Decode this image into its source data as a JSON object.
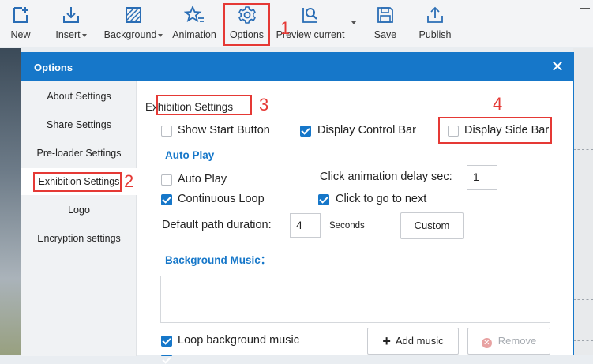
{
  "toolbar": {
    "new": "New",
    "insert": "Insert",
    "background": "Background",
    "animation": "Animation",
    "options": "Options",
    "preview": "Preview current",
    "save": "Save",
    "publish": "Publish"
  },
  "callouts": [
    "1",
    "2",
    "3",
    "4"
  ],
  "dialog": {
    "title": "Options",
    "close": "✕"
  },
  "sidebar": {
    "items": [
      {
        "label": "About Settings"
      },
      {
        "label": "Share Settings"
      },
      {
        "label": "Pre-loader Settings"
      },
      {
        "label": "Exhibition Settings"
      },
      {
        "label": "Logo"
      },
      {
        "label": "Encryption settings"
      }
    ]
  },
  "exhibition": {
    "section_title": "Exhibition Settings",
    "show_start_button": {
      "label": "Show Start Button",
      "checked": false
    },
    "display_control_bar": {
      "label": "Display Control Bar",
      "checked": true
    },
    "display_side_bar": {
      "label": "Display Side Bar",
      "checked": false
    },
    "auto_play_heading": "Auto Play",
    "auto_play": {
      "label": "Auto Play",
      "checked": false
    },
    "continuous_loop": {
      "label": "Continuous Loop",
      "checked": true
    },
    "click_delay_label": "Click animation delay sec:",
    "click_delay_value": "1",
    "click_to_next": {
      "label": "Click to go to next",
      "checked": true
    },
    "path_duration_label": "Default path duration:",
    "path_duration_value": "4",
    "seconds": "Seconds",
    "custom_button": "Custom",
    "bg_music_heading": "Background Music：",
    "loop_music": {
      "label": "Loop background music",
      "checked": true
    },
    "add_music_button": "Add music",
    "remove_button": "Remove"
  },
  "colors": {
    "accent": "#1677c9",
    "callout": "#e53935"
  }
}
